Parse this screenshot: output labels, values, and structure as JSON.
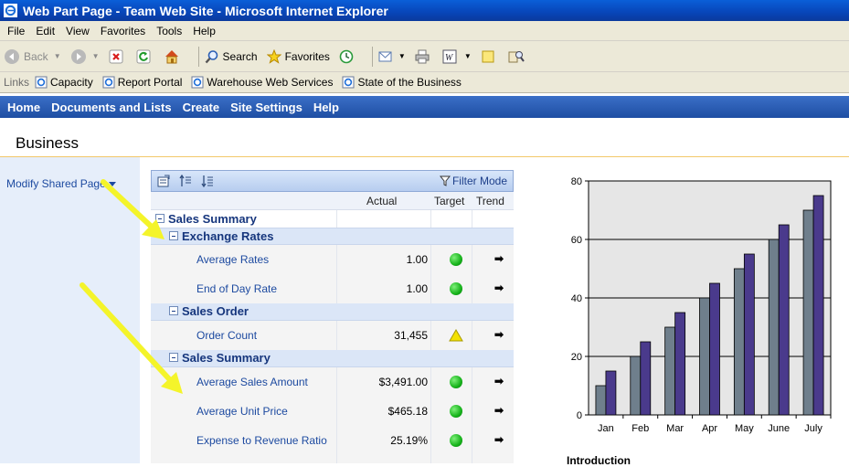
{
  "window": {
    "title": "Web Part Page - Team Web Site - Microsoft Internet Explorer"
  },
  "menu": [
    "File",
    "Edit",
    "View",
    "Favorites",
    "Tools",
    "Help"
  ],
  "toolbar": {
    "back": "Back",
    "search": "Search",
    "favorites": "Favorites"
  },
  "links": {
    "label": "Links",
    "items": [
      "Capacity",
      "Report Portal",
      "Warehouse Web Services",
      "State of the Business"
    ]
  },
  "topnav": [
    "Home",
    "Documents and Lists",
    "Create",
    "Site Settings",
    "Help"
  ],
  "page": {
    "title": "Business",
    "modify_label": "Modify Shared Page"
  },
  "scorecard": {
    "filter_label": "Filter Mode",
    "columns": {
      "actual": "Actual",
      "target": "Target",
      "trend": "Trend"
    },
    "groups": [
      {
        "label": "Sales Summary",
        "top": true
      },
      {
        "label": "Exchange Rates"
      },
      {
        "label": "Sales Order"
      },
      {
        "label": "Sales Summary"
      }
    ],
    "items": [
      {
        "label": "Average Rates",
        "actual": "1.00",
        "status": "green",
        "trend": "➡"
      },
      {
        "label": "End of Day Rate",
        "actual": "1.00",
        "status": "green",
        "trend": "➡"
      },
      {
        "label": "Order Count",
        "actual": "31,455",
        "status": "yellow",
        "trend": "➡"
      },
      {
        "label": "Average Sales Amount",
        "actual": "$3,491.00",
        "status": "green",
        "trend": "➡"
      },
      {
        "label": "Average Unit Price",
        "actual": "$465.18",
        "status": "green",
        "trend": "➡"
      },
      {
        "label": "Expense to Revenue Ratio",
        "actual": "25.19%",
        "status": "green",
        "trend": "➡"
      }
    ],
    "colors": {
      "green": "#16b21a",
      "yellow": "#f3e100"
    }
  },
  "intro": {
    "label": "Introduction"
  },
  "chart_data": {
    "type": "bar",
    "categories": [
      "Jan",
      "Feb",
      "Mar",
      "Apr",
      "May",
      "June",
      "July"
    ],
    "series": [
      {
        "values": [
          10,
          20,
          30,
          40,
          50,
          60,
          70
        ],
        "color": "#6f7f8c"
      },
      {
        "values": [
          15,
          25,
          35,
          45,
          55,
          65,
          75
        ],
        "color": "#4a3a8c"
      }
    ],
    "yticks": [
      "0",
      "20",
      "40",
      "60",
      "80"
    ],
    "ylim": [
      0,
      80
    ],
    "grid": true,
    "title": "",
    "xlabel": "",
    "ylabel": ""
  }
}
